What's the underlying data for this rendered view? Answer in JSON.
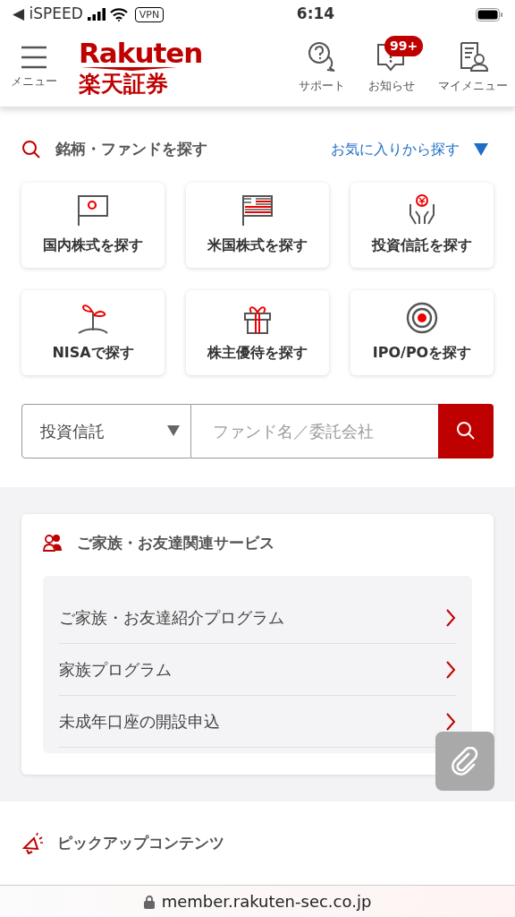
{
  "status_bar": {
    "back_app": "◀ iSPEED",
    "vpn": "VPN",
    "time": "6:14"
  },
  "header": {
    "menu_label": "メニュー",
    "logo_top": "Rakuten",
    "logo_bottom": "楽天証券",
    "actions": [
      {
        "kind": "support",
        "label": "サポート"
      },
      {
        "kind": "notice",
        "label": "お知らせ",
        "badge": "99+"
      },
      {
        "kind": "mymenu",
        "label": "マイメニュー"
      }
    ]
  },
  "search": {
    "title": "銘柄・ファンドを探す",
    "favorites_link": "お気に入りから探す",
    "tiles": [
      {
        "kind": "jp-flag",
        "label": "国内株式を探す"
      },
      {
        "kind": "us-flag",
        "label": "米国株式を探す"
      },
      {
        "kind": "yen-hands",
        "label": "投資信託を探す"
      },
      {
        "kind": "sprout",
        "label": "NISAで探す"
      },
      {
        "kind": "gift",
        "label": "株主優待を探す"
      },
      {
        "kind": "target",
        "label": "IPO/POを探す"
      }
    ],
    "category": "投資信託",
    "placeholder": "ファンド名／委託会社"
  },
  "family_card": {
    "title": "ご家族・お友達関連サービス",
    "items": [
      "ご家族・お友達紹介プログラム",
      "家族プログラム",
      "未成年口座の開設申込"
    ]
  },
  "pickup": {
    "title": "ピックアップコンテンツ"
  },
  "url_bar": {
    "url": "member.rakuten-sec.co.jp"
  }
}
